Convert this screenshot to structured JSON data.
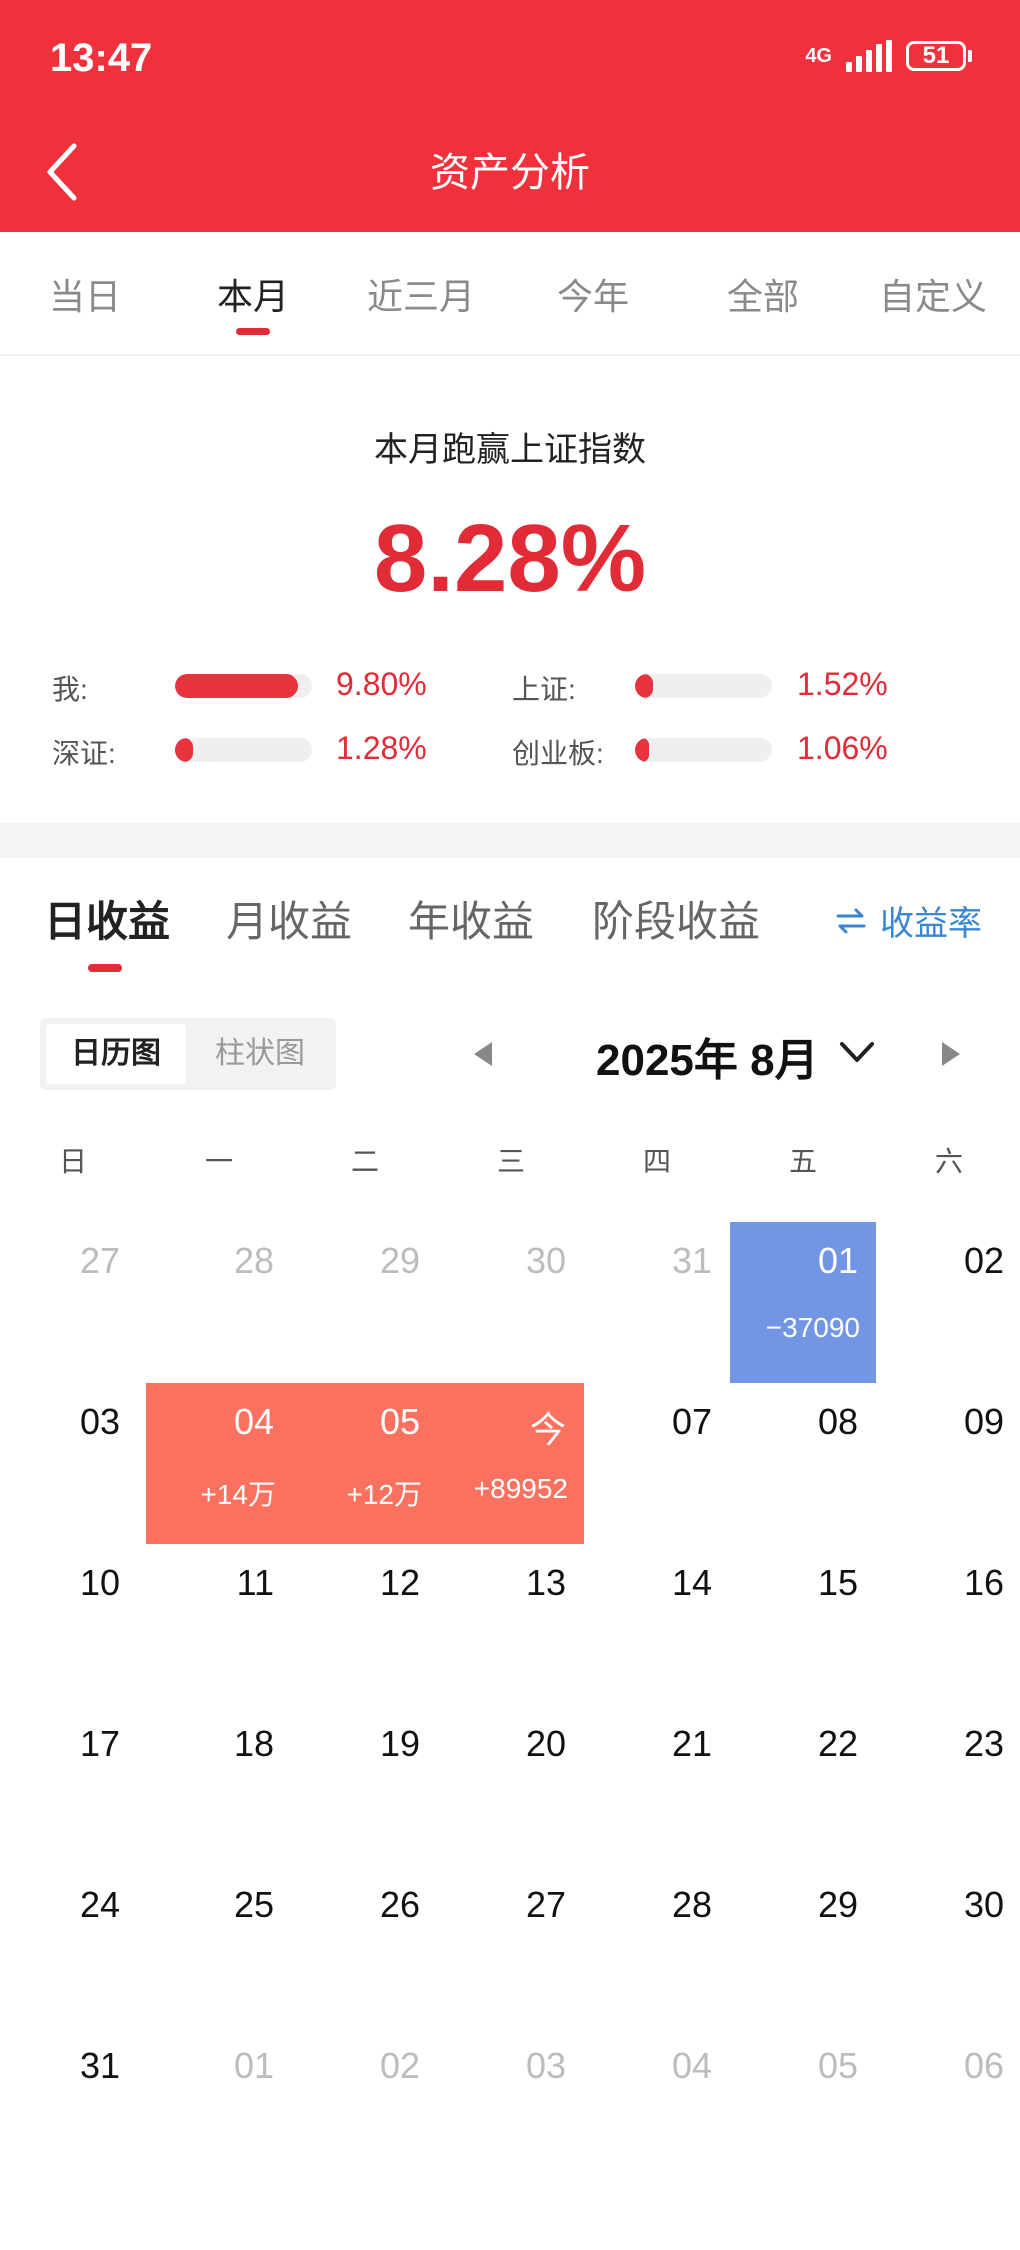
{
  "status_bar": {
    "time": "13:47",
    "network": "4G",
    "battery": "51"
  },
  "header": {
    "title": "资产分析"
  },
  "period_tabs": [
    "当日",
    "本月",
    "近三月",
    "今年",
    "全部",
    "自定义"
  ],
  "summary": {
    "title": "本月跑赢上证指数",
    "value": "8.28%",
    "comparisons": [
      {
        "label": "我:",
        "value": "9.80%",
        "level": 0.9
      },
      {
        "label": "上证:",
        "value": "1.52%",
        "level": 0.13
      },
      {
        "label": "深证:",
        "value": "1.28%",
        "level": 0.13
      },
      {
        "label": "创业板:",
        "value": "1.06%",
        "level": 0.1
      }
    ]
  },
  "profit_tabs": [
    "日收益",
    "月收益",
    "年收益",
    "阶段收益"
  ],
  "rate_toggle": {
    "icon": "swap-arrows-icon",
    "label": "收益率"
  },
  "chart_toggle": {
    "calendar": "日历图",
    "bar": "柱状图"
  },
  "month": {
    "label": "2025年 8月"
  },
  "weekdays": [
    "日",
    "一",
    "二",
    "三",
    "四",
    "五",
    "六"
  ],
  "calendar_rows": [
    [
      {
        "d": "27",
        "muted": true
      },
      {
        "d": "28",
        "muted": true
      },
      {
        "d": "29",
        "muted": true
      },
      {
        "d": "30",
        "muted": true
      },
      {
        "d": "31",
        "muted": true
      },
      {
        "d": "01",
        "pnl": "−37090",
        "type": "loss"
      },
      {
        "d": "02"
      }
    ],
    [
      {
        "d": "03"
      },
      {
        "d": "04",
        "pnl": "+14万",
        "type": "gain"
      },
      {
        "d": "05",
        "pnl": "+12万",
        "type": "gain"
      },
      {
        "d": "今",
        "pnl": "+89952",
        "type": "gain"
      },
      {
        "d": "07"
      },
      {
        "d": "08"
      },
      {
        "d": "09"
      }
    ],
    [
      {
        "d": "10"
      },
      {
        "d": "11"
      },
      {
        "d": "12"
      },
      {
        "d": "13"
      },
      {
        "d": "14"
      },
      {
        "d": "15"
      },
      {
        "d": "16"
      }
    ],
    [
      {
        "d": "17"
      },
      {
        "d": "18"
      },
      {
        "d": "19"
      },
      {
        "d": "20"
      },
      {
        "d": "21"
      },
      {
        "d": "22"
      },
      {
        "d": "23"
      }
    ],
    [
      {
        "d": "24"
      },
      {
        "d": "25"
      },
      {
        "d": "26"
      },
      {
        "d": "27"
      },
      {
        "d": "28"
      },
      {
        "d": "29"
      },
      {
        "d": "30"
      }
    ],
    [
      {
        "d": "31"
      },
      {
        "d": "01",
        "muted": true
      },
      {
        "d": "02",
        "muted": true
      },
      {
        "d": "03",
        "muted": true
      },
      {
        "d": "04",
        "muted": true
      },
      {
        "d": "05",
        "muted": true
      },
      {
        "d": "06",
        "muted": true
      }
    ]
  ]
}
